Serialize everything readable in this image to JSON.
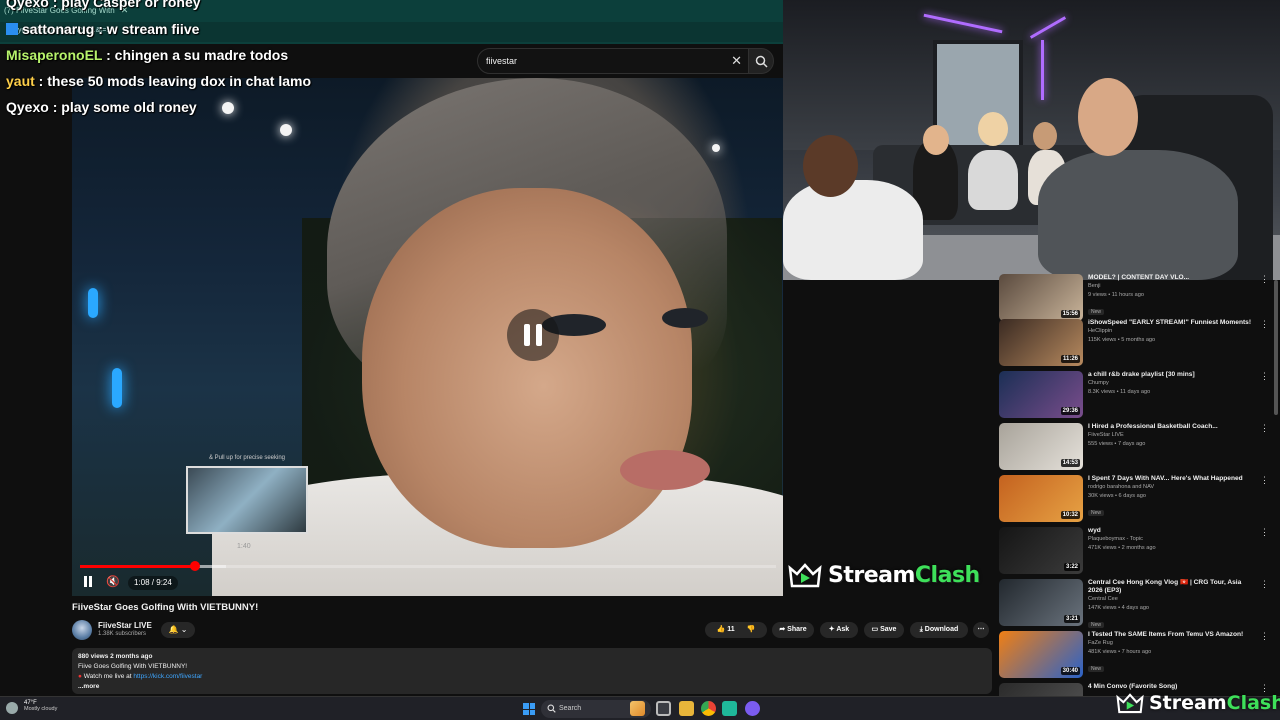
{
  "browser": {
    "tab_title": "(7) FiiveStar Goes Golfing With",
    "url": "youtube.com/watch?v=...&t=10s"
  },
  "search": {
    "query": "fiivestar",
    "placeholder": "Search"
  },
  "chat": [
    {
      "user": "Qyexo",
      "text": "play Casper or roney",
      "color": "#ffffff"
    },
    {
      "user": "sattonarug",
      "text": "w stream fiive",
      "color": "#ffffff",
      "badge": true
    },
    {
      "user": "MisaperonoEL",
      "text": "chingen a su madre todos",
      "color": "#b7f36b"
    },
    {
      "user": "yaut",
      "text": "these 50 mods leaving dox in chat lamo",
      "color": "#ffd04a"
    },
    {
      "user": "Qyexo",
      "text": "play some old roney",
      "color": "#ffffff"
    }
  ],
  "player": {
    "current_time": "1:08",
    "duration": "9:24",
    "time_text": "1:08 / 9:24",
    "played_fraction": 0.165,
    "buffered_fraction": 0.21,
    "preview_caption": "& Pull up for precise seeking",
    "preview_time": "1:40"
  },
  "watermark": {
    "main": "Stream",
    "accent": "Clash"
  },
  "video": {
    "title": "FiiveStar Goes Golfing With VIETBUNNY!",
    "channel": "FiiveStar LIVE",
    "subscribers": "1.38K subscribers",
    "likes": "11",
    "share_label": "Share",
    "ask_label": "Ask",
    "save_label": "Save",
    "download_label": "Download",
    "more_label": "⋯"
  },
  "description": {
    "stats": "880 views  2 months ago",
    "line1": "Fiive Goes Golfing With VIETBUNNY!",
    "line2_prefix": "Watch me live at ",
    "link": "https://kick.com/fiivestar",
    "more": "...more"
  },
  "recommendations": [
    {
      "title": "MODEL? | CONTENT DAY VLO...",
      "channel": "Benji",
      "meta": "9 views • 11 hours ago",
      "duration": "15:56",
      "new": "New",
      "thumb": [
        "#5a4a3e",
        "#c9b49a"
      ]
    },
    {
      "title": "iShowSpeed \"EARLY STREAM!\" Funniest Moments!",
      "channel": "HeClippin",
      "meta": "115K views • 5 months ago",
      "duration": "11:26",
      "new": "",
      "thumb": [
        "#3a2a22",
        "#b78a5f"
      ]
    },
    {
      "title": "a chill r&b drake playlist [30 mins]",
      "channel": "Chumpy",
      "meta": "8.3K views • 11 days ago",
      "duration": "29:36",
      "new": "",
      "thumb": [
        "#1b2f55",
        "#7a4d8c"
      ]
    },
    {
      "title": "I Hired a Professional Basketball Coach...",
      "channel": "FiiveStar LIVE",
      "meta": "555 views • 7 days ago",
      "duration": "14:53",
      "new": "",
      "thumb": [
        "#a8a39a",
        "#e5e1da"
      ]
    },
    {
      "title": "I Spent 7 Days With NAV... Here's What Happened",
      "channel": "rodrigo barahona and NAV",
      "meta": "30K views • 6 days ago",
      "duration": "10:32",
      "new": "New",
      "thumb": [
        "#c4621f",
        "#e7a244"
      ]
    },
    {
      "title": "wyd",
      "channel": "Plaqueboymax - Topic",
      "meta": "471K views • 2 months ago",
      "duration": "3:22",
      "new": "",
      "thumb": [
        "#151515",
        "#3b3b3b"
      ]
    },
    {
      "title": "Central Cee Hong Kong Vlog 🇭🇰 | CRG Tour, Asia 2026 (EP3)",
      "channel": "Central Cee",
      "meta": "147K views • 4 days ago",
      "duration": "3:21",
      "new": "New",
      "thumb": [
        "#22282e",
        "#6a737d"
      ]
    },
    {
      "title": "I Tested The SAME Items From Temu VS Amazon!",
      "channel": "FaZe Rug",
      "meta": "481K views • 7 hours ago",
      "duration": "30:40",
      "new": "New",
      "thumb": [
        "#f07f14",
        "#2a62c9"
      ]
    },
    {
      "title": "4 Min Convo (Favorite Song)",
      "channel": "",
      "meta": "",
      "duration": "",
      "new": "",
      "thumb": [
        "#2b2b2b",
        "#555555"
      ]
    }
  ],
  "taskbar": {
    "weather_temp": "47°F",
    "weather_cond": "Mostly cloudy",
    "search_label": "Search"
  },
  "colors": {
    "youtube_red": "#ff0000",
    "link_blue": "#3ea6ff",
    "brand_green": "#3ee05a"
  }
}
